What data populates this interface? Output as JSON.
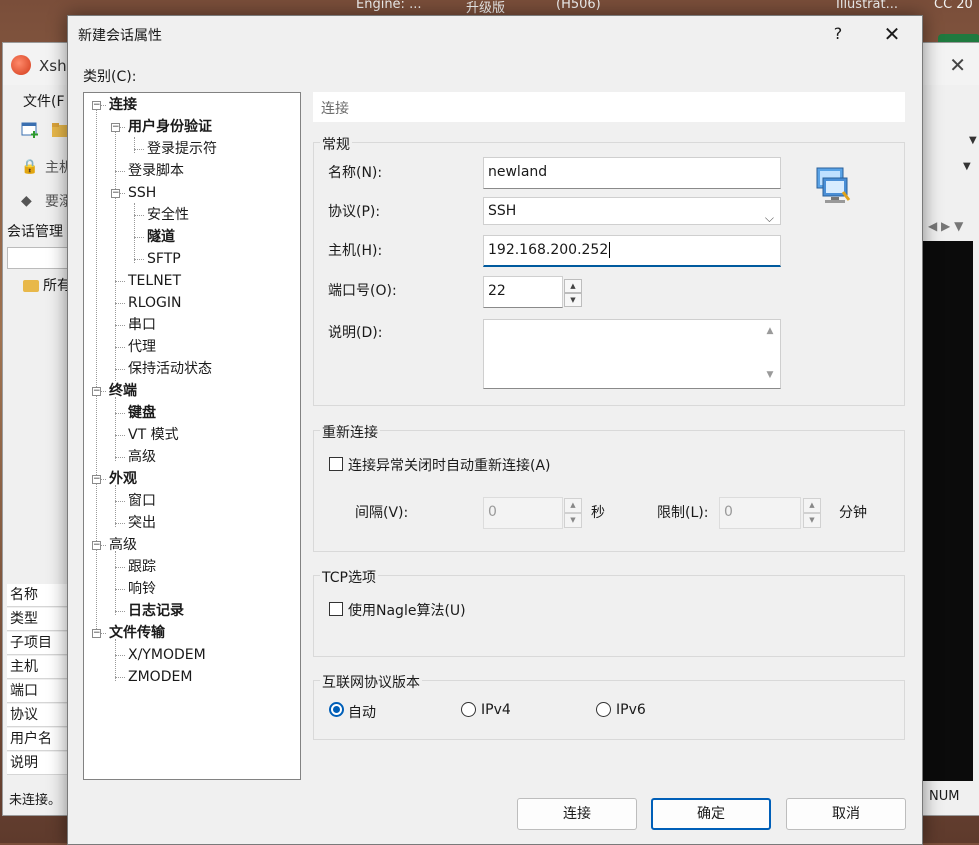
{
  "desktop": {
    "labels": [
      "Engine: ...",
      "升级版",
      "(H506)",
      "Illustrat...",
      "CC 20"
    ]
  },
  "background_window": {
    "app_name": "Xshe",
    "menu_file": "文件(F",
    "address_host": "主机",
    "address_hint": "要溺",
    "session_manager": "会话管理",
    "tree_item": "所有",
    "props": [
      "名称",
      "类型",
      "子项目",
      "主机",
      "端口",
      "协议",
      "用户名",
      "说明"
    ],
    "status": "未连接。",
    "num_indicator": "NUM"
  },
  "dialog": {
    "title": "新建会话属性",
    "help": "?",
    "close": "✕",
    "category_label": "类别(C):",
    "tree": [
      {
        "label": "连接",
        "bold": true,
        "level": 0,
        "expander": "−"
      },
      {
        "label": "用户身份验证",
        "bold": true,
        "level": 1,
        "expander": "−"
      },
      {
        "label": "登录提示符",
        "bold": false,
        "level": 2
      },
      {
        "label": "登录脚本",
        "bold": false,
        "level": 1
      },
      {
        "label": "SSH",
        "bold": false,
        "level": 1,
        "expander": "−"
      },
      {
        "label": "安全性",
        "bold": false,
        "level": 2
      },
      {
        "label": "隧道",
        "bold": true,
        "level": 2
      },
      {
        "label": "SFTP",
        "bold": false,
        "level": 2
      },
      {
        "label": "TELNET",
        "bold": false,
        "level": 1
      },
      {
        "label": "RLOGIN",
        "bold": false,
        "level": 1
      },
      {
        "label": "串口",
        "bold": false,
        "level": 1
      },
      {
        "label": "代理",
        "bold": false,
        "level": 1
      },
      {
        "label": "保持活动状态",
        "bold": false,
        "level": 1
      },
      {
        "label": "终端",
        "bold": true,
        "level": 0,
        "expander": "−"
      },
      {
        "label": "键盘",
        "bold": true,
        "level": 1
      },
      {
        "label": "VT 模式",
        "bold": false,
        "level": 1
      },
      {
        "label": "高级",
        "bold": false,
        "level": 1
      },
      {
        "label": "外观",
        "bold": true,
        "level": 0,
        "expander": "−"
      },
      {
        "label": "窗口",
        "bold": false,
        "level": 1
      },
      {
        "label": "突出",
        "bold": false,
        "level": 1
      },
      {
        "label": "高级",
        "bold": false,
        "level": 0,
        "expander": "−"
      },
      {
        "label": "跟踪",
        "bold": false,
        "level": 1
      },
      {
        "label": "响铃",
        "bold": false,
        "level": 1
      },
      {
        "label": "日志记录",
        "bold": true,
        "level": 1
      },
      {
        "label": "文件传输",
        "bold": true,
        "level": 0,
        "expander": "−"
      },
      {
        "label": "X/YMODEM",
        "bold": false,
        "level": 1
      },
      {
        "label": "ZMODEM",
        "bold": false,
        "level": 1
      }
    ],
    "pane_header": "连接",
    "general": {
      "title": "常规",
      "name_label": "名称(N):",
      "name_value": "newland",
      "protocol_label": "协议(P):",
      "protocol_value": "SSH",
      "host_label": "主机(H):",
      "host_value": "192.168.200.252",
      "port_label": "端口号(O):",
      "port_value": "22",
      "desc_label": "说明(D):",
      "desc_value": ""
    },
    "reconnect": {
      "title": "重新连接",
      "checkbox_label": "连接异常关闭时自动重新连接(A)",
      "checked": false,
      "interval_label": "间隔(V):",
      "interval_value": "0",
      "interval_unit": "秒",
      "limit_label": "限制(L):",
      "limit_value": "0",
      "limit_unit": "分钟"
    },
    "tcp": {
      "title": "TCP选项",
      "nagle_label": "使用Nagle算法(U)",
      "checked": false
    },
    "ip_version": {
      "title": "互联网协议版本",
      "options": [
        "自动",
        "IPv4",
        "IPv6"
      ],
      "selected": "自动"
    },
    "buttons": {
      "connect": "连接",
      "ok": "确定",
      "cancel": "取消"
    },
    "accent_color": "#005fb8"
  }
}
